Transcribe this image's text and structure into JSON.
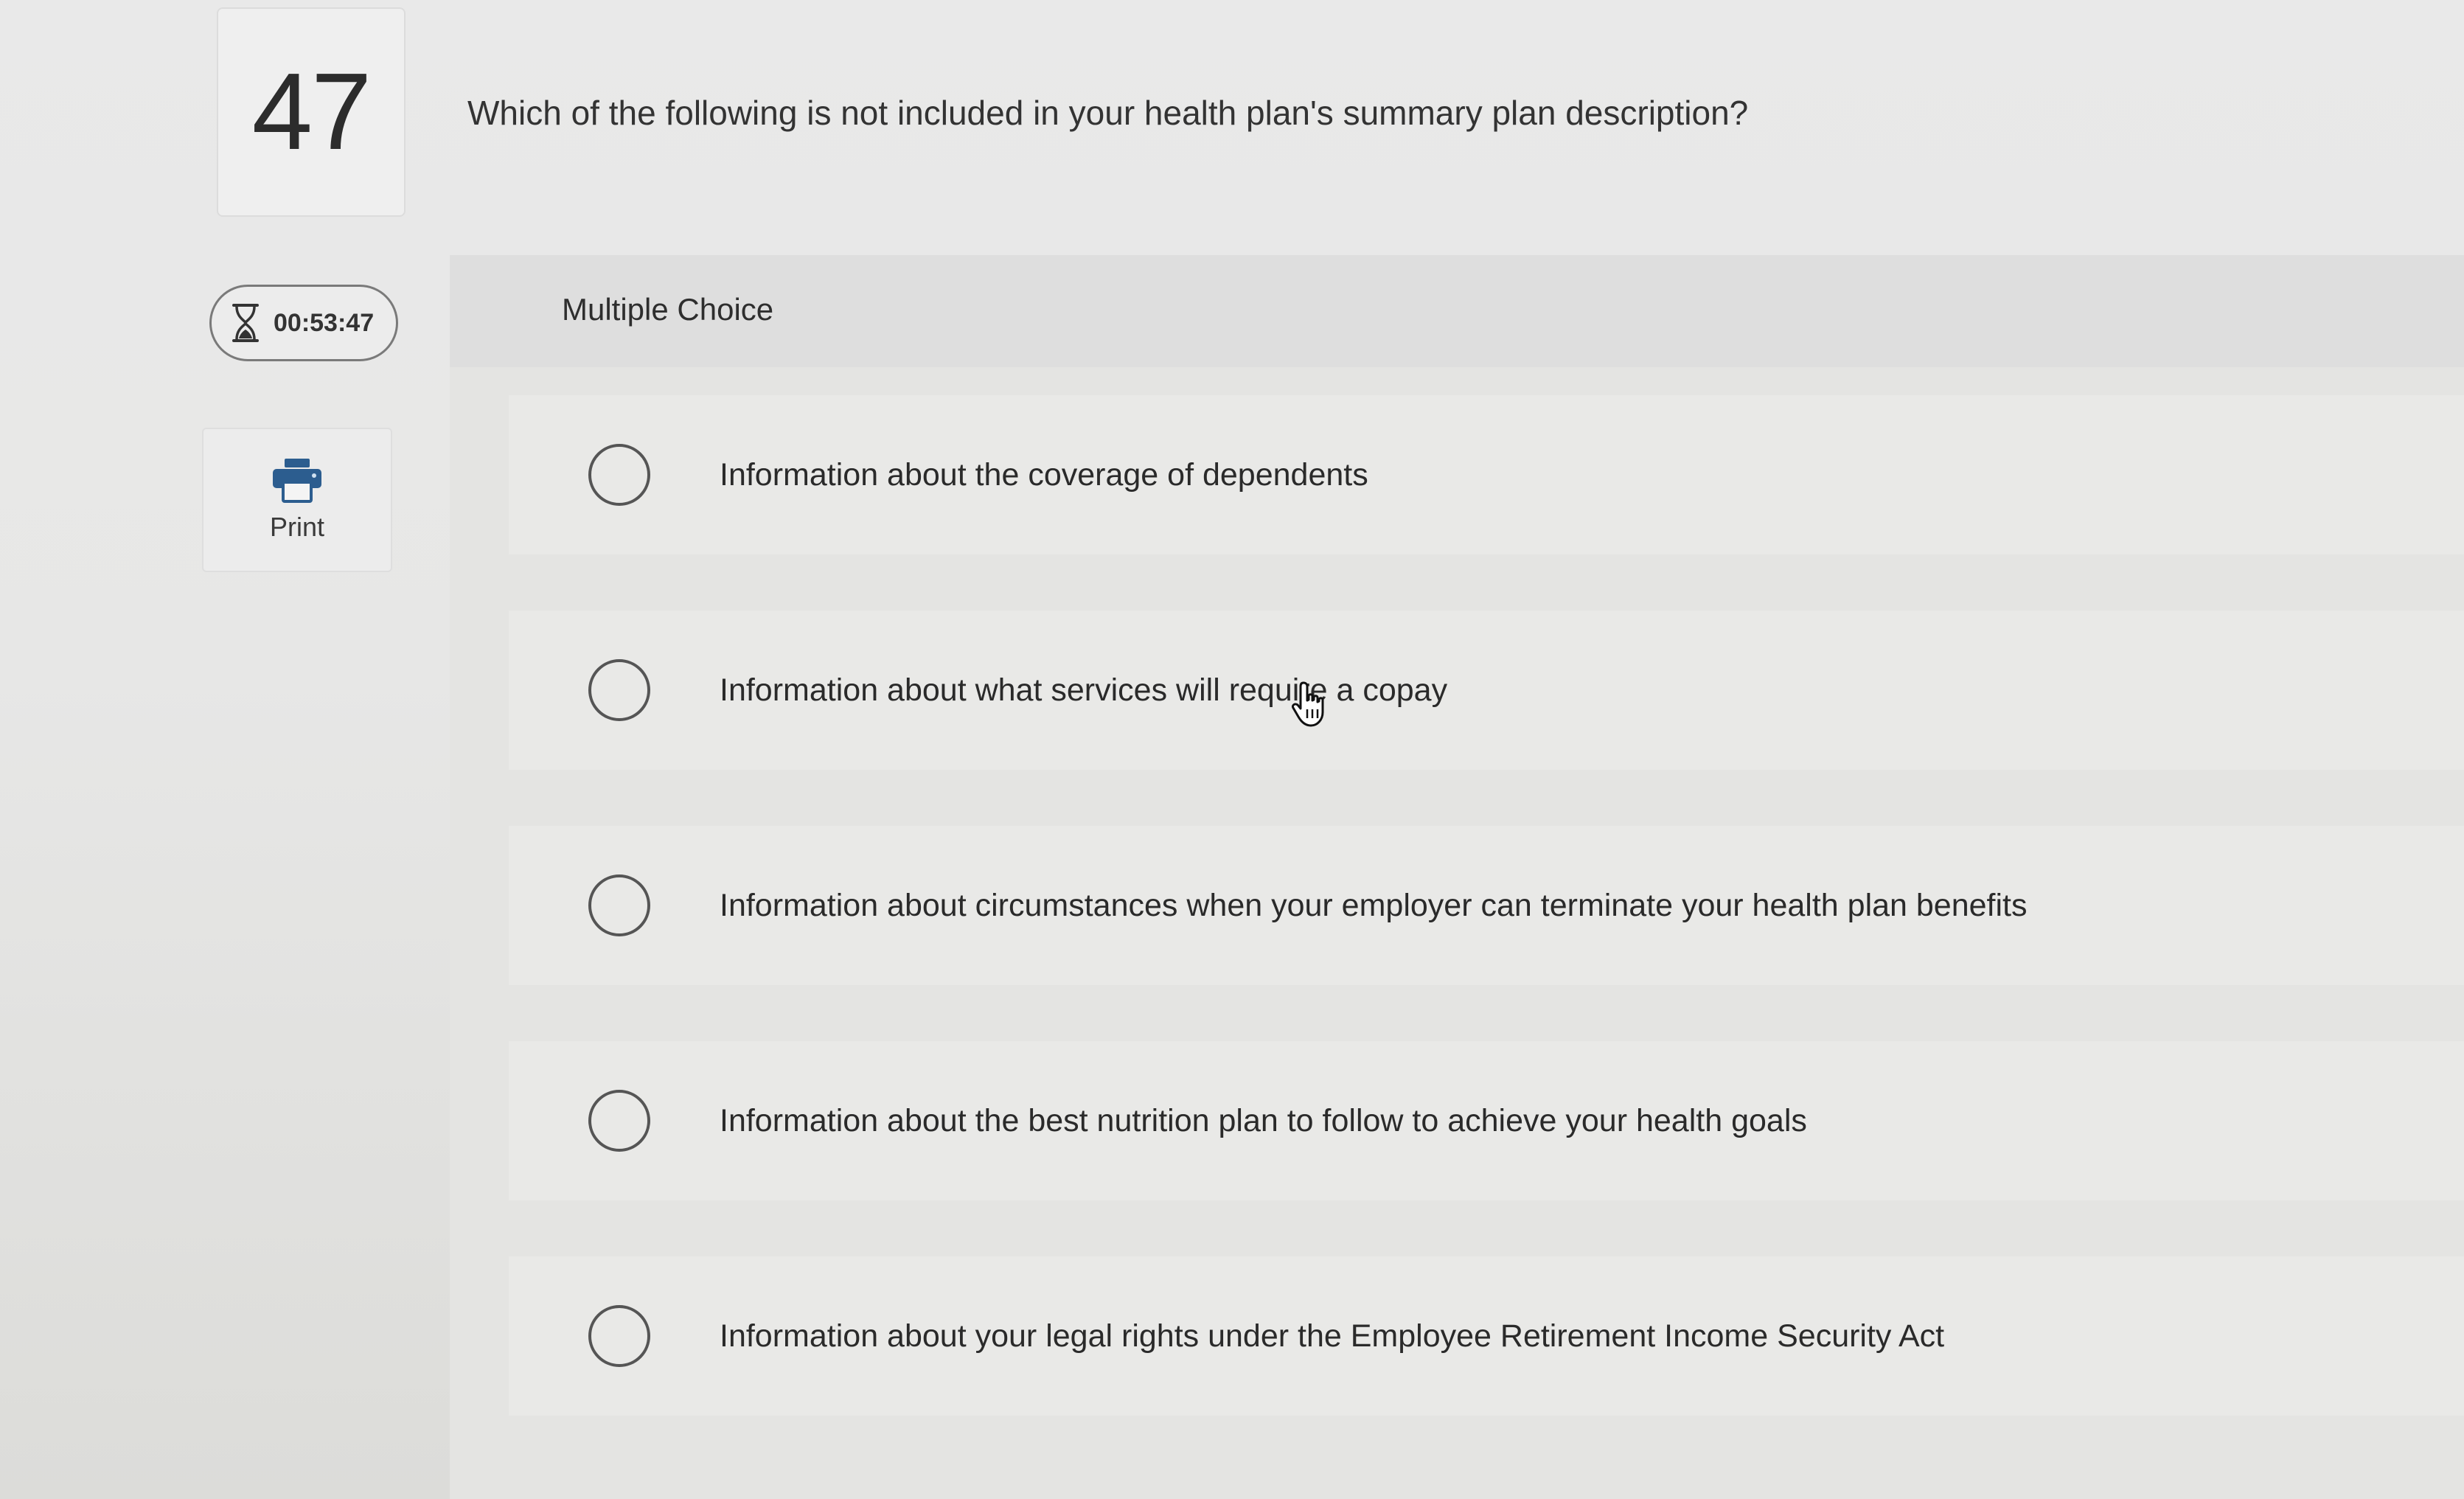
{
  "question": {
    "number": "47",
    "text": "Which of the following is not included in your health plan's summary plan description?"
  },
  "timer": {
    "icon": "hourglass-icon",
    "value": "00:53:47"
  },
  "print_button": {
    "icon": "printer-icon",
    "label": "Print"
  },
  "answer_panel": {
    "type_label": "Multiple Choice",
    "options": [
      {
        "label": "Information about the coverage of dependents",
        "selected": false
      },
      {
        "label": "Information about what services will require a copay",
        "selected": false
      },
      {
        "label": "Information about circumstances when your employer can terminate your health plan benefits",
        "selected": false
      },
      {
        "label": "Information about the best nutrition plan to follow to achieve your health goals",
        "selected": false
      },
      {
        "label": "Information about your legal rights under the Employee Retirement Income Security Act",
        "selected": false
      }
    ]
  },
  "cursor": {
    "icon": "hand-pointer-icon"
  },
  "colors": {
    "print_icon_blue": "#2c5d8f",
    "radio_border": "#555555",
    "panel_background": "#e4e4e2"
  }
}
